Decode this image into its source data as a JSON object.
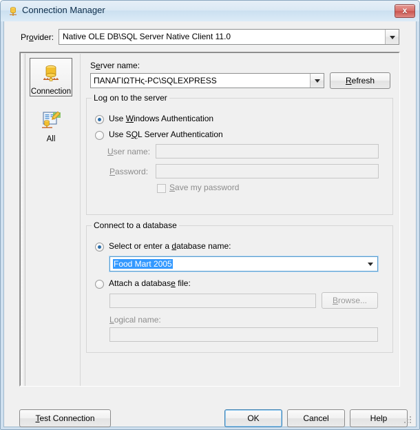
{
  "window": {
    "title": "Connection Manager",
    "title_icon": "connection-icon",
    "close_label": "x"
  },
  "provider": {
    "label": "Provider:",
    "label_accel": "o",
    "value": "Native OLE DB\\SQL Server Native Client 11.0"
  },
  "sidebar": {
    "items": [
      {
        "label": "Connection",
        "icon": "database-connection-icon",
        "selected": true
      },
      {
        "label": "All",
        "icon": "all-properties-icon",
        "selected": false
      }
    ]
  },
  "server": {
    "label": "Server name:",
    "value": "ΠΑΝΑΓΙΩΤΗς-PC\\SQLEXPRESS",
    "refresh_label": "Refresh"
  },
  "logon": {
    "group_title": "Log on to the server",
    "windows_auth_label": "Use Windows Authentication",
    "windows_auth_checked": true,
    "sql_auth_label": "Use SQL Server Authentication",
    "sql_auth_checked": false,
    "username_label": "User name:",
    "username_value": "",
    "password_label": "Password:",
    "password_value": "",
    "save_password_label": "Save my password",
    "save_password_checked": false
  },
  "database": {
    "group_title": "Connect to a database",
    "select_db_label": "Select or enter a database name:",
    "select_db_checked": true,
    "selected_database": "Food Mart 2005",
    "attach_file_label": "Attach a database file:",
    "attach_file_checked": false,
    "attach_file_value": "",
    "browse_label": "Browse...",
    "logical_name_label": "Logical name:",
    "logical_name_value": ""
  },
  "footer": {
    "test_connection_label": "Test Connection",
    "ok_label": "OK",
    "cancel_label": "Cancel",
    "help_label": "Help"
  },
  "colors": {
    "accent": "#3399ff",
    "title_bar": "#dbe9f4",
    "dialog_bg": "#f0f0f0",
    "close_button": "#d8706a",
    "default_button_border": "#3c7fb1"
  }
}
